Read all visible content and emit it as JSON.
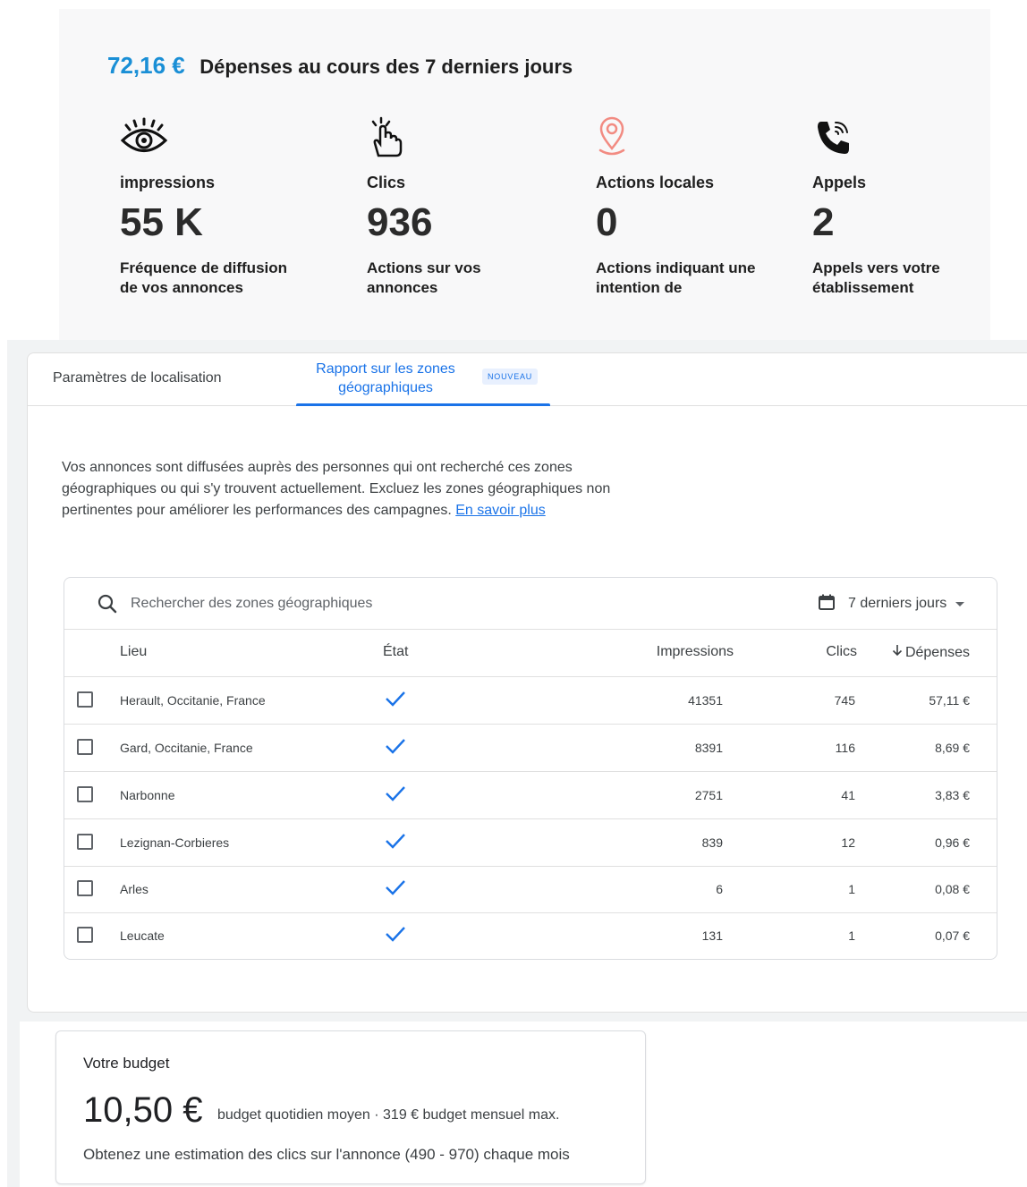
{
  "summary": {
    "amount": "72,16 €",
    "title": "Dépenses au cours des 7 derniers jours",
    "metrics": [
      {
        "icon": "eye-icon",
        "label": "impressions",
        "value": "55 K",
        "desc_line1": "Fréquence de diffusion",
        "desc_line2": "de vos annonces"
      },
      {
        "icon": "click-hand-icon",
        "label": "Clics",
        "value": "936",
        "desc_line1": "Actions  sur vos",
        "desc_line2": "annonces"
      },
      {
        "icon": "location-pin-icon",
        "label": "Actions locales",
        "value": "0",
        "desc_line1": "Actions indiquant une",
        "desc_line2": "intention de"
      },
      {
        "icon": "phone-icon",
        "label": "Appels",
        "value": "2",
        "desc_line1": "Appels vers votre",
        "desc_line2": "établissement"
      }
    ]
  },
  "tabs": {
    "location_settings": "Paramètres de localisation",
    "geo_report_line1": "Rapport sur les zones",
    "geo_report_line2": "géographiques",
    "badge": "NOUVEAU"
  },
  "intro": {
    "text": "Vos annonces sont diffusées auprès des personnes qui ont recherché ces zones géographiques ou qui s'y trouvent actuellement. Excluez les zones géographiques non pertinentes pour améliorer les performances des campagnes.",
    "link": "En savoir plus"
  },
  "search": {
    "placeholder": "Rechercher des zones géographiques",
    "date_range": "7 derniers jours"
  },
  "table": {
    "headers": {
      "place": "Lieu",
      "state": "État",
      "impressions": "Impressions",
      "clicks": "Clics",
      "cost": "Dépenses"
    },
    "rows": [
      {
        "place": "Herault, Occitanie, France",
        "impressions": "41351",
        "clicks": "745",
        "cost": "57,11 €"
      },
      {
        "place": "Gard, Occitanie, France",
        "impressions": "8391",
        "clicks": "116",
        "cost": "8,69 €"
      },
      {
        "place": "Narbonne",
        "impressions": "2751",
        "clicks": "41",
        "cost": "3,83 €"
      },
      {
        "place": "Lezignan-Corbieres",
        "impressions": "839",
        "clicks": "12",
        "cost": "0,96 €"
      },
      {
        "place": "Arles",
        "impressions": "6",
        "clicks": "1",
        "cost": "0,08 €"
      },
      {
        "place": "Leucate",
        "impressions": "131",
        "clicks": "1",
        "cost": "0,07 €"
      }
    ]
  },
  "budget": {
    "title": "Votre budget",
    "amount": "10,50 €",
    "daily_text": "budget quotidien moyen · 319 €  budget mensuel max.",
    "estimate": "Obtenez une estimation des clics sur l'annonce (490 - 970) chaque mois"
  },
  "colors": {
    "accent": "#1a73e8",
    "amount": "#1a8fd6",
    "pin": "#f28b82"
  }
}
